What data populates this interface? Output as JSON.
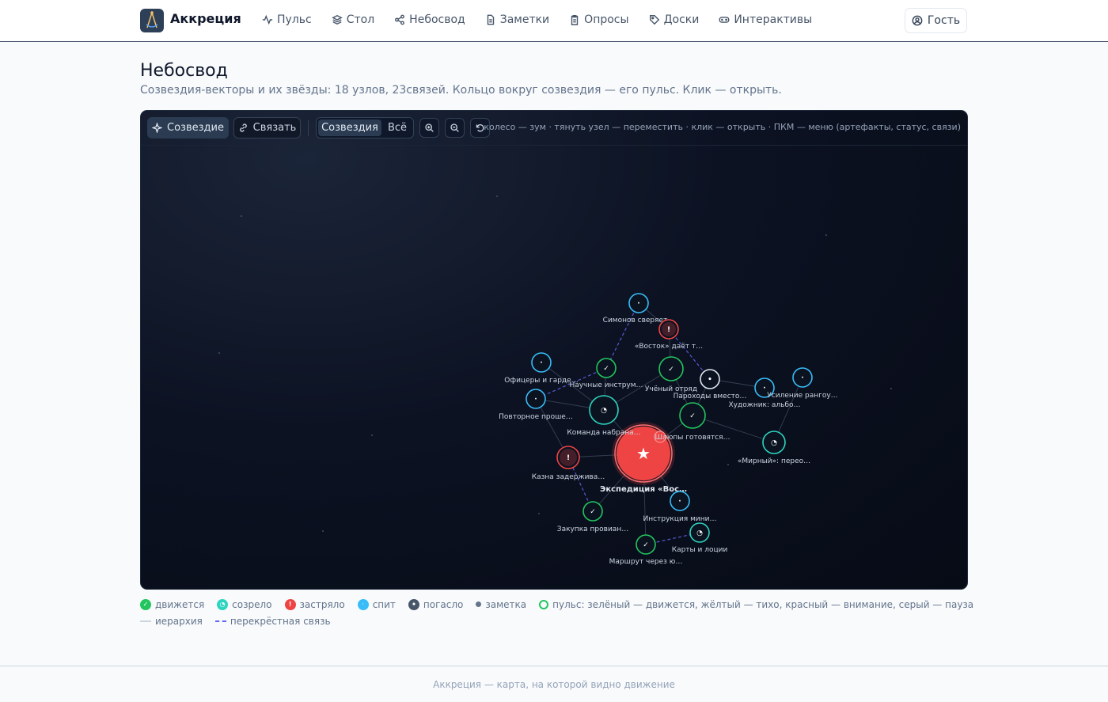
{
  "header": {
    "brand": "Аккреция",
    "nav": [
      {
        "label": "Пульс",
        "icon": "pulse-icon"
      },
      {
        "label": "Стол",
        "icon": "layers-icon"
      },
      {
        "label": "Небосвод",
        "icon": "share-nodes-icon"
      },
      {
        "label": "Заметки",
        "icon": "file-icon"
      },
      {
        "label": "Опросы",
        "icon": "clipboard-icon"
      },
      {
        "label": "Доски",
        "icon": "tag-icon"
      },
      {
        "label": "Интерактивы",
        "icon": "gamepad-icon"
      }
    ],
    "guest_label": "Гость"
  },
  "page": {
    "title": "Небосвод",
    "subtitle": "Созвездия-векторы и их звёзды: 18 узлов, 23связей. Кольцо вокруг созвездия — его пульс. Клик — открыть."
  },
  "toolbar": {
    "constellation_label": "Созвездие",
    "link_label": "Связать",
    "view_constellations": "Созвездия",
    "view_all": "Всё",
    "hint": "колесо — зум · тянуть узел — переместить · клик — открыть · ПКМ — меню (артефакты, статус, связи)"
  },
  "graph": {
    "colors": {
      "moving": "#22c55e",
      "ripe": "#2dd4bf",
      "stuck": "#ef4444",
      "sleeping": "#38bdf8",
      "faded": "#475569",
      "white": "#e2e8f0"
    },
    "nodes": [
      {
        "id": "main",
        "label": "Экспедиция «Вос…",
        "status": "stuck",
        "glyph": "★"
      },
      {
        "id": "simonov",
        "label": "Симонов сверяет…",
        "status": "sleeping",
        "glyph": "·"
      },
      {
        "id": "vostok",
        "label": "«Восток» даёт т…",
        "status": "stuck",
        "glyph": "!"
      },
      {
        "id": "officers",
        "label": "Офицеры и гарде…",
        "status": "sleeping",
        "glyph": "·"
      },
      {
        "id": "sci",
        "label": "Научные инструм…",
        "status": "moving",
        "glyph": "✓"
      },
      {
        "id": "scholar",
        "label": "Учёный отряд",
        "status": "moving",
        "glyph": "✓"
      },
      {
        "id": "steamers",
        "label": "Пароходы вместо…",
        "status": "white",
        "glyph": "•"
      },
      {
        "id": "artist",
        "label": "Художник: альбо…",
        "status": "sleeping",
        "glyph": "·"
      },
      {
        "id": "rangout",
        "label": "Усиление рангоу…",
        "status": "sleeping",
        "glyph": "·"
      },
      {
        "id": "repeat",
        "label": "Повторное проше…",
        "status": "sleeping",
        "glyph": "·"
      },
      {
        "id": "crew",
        "label": "Команда набрана…",
        "status": "ripe",
        "glyph": "◔"
      },
      {
        "id": "sloops",
        "label": "Шлюпы готовятся…",
        "status": "moving",
        "glyph": "✓"
      },
      {
        "id": "mirny",
        "label": "«Мирный»: перео…",
        "status": "ripe",
        "glyph": "◔"
      },
      {
        "id": "treasury",
        "label": "Казна задержива…",
        "status": "stuck",
        "glyph": "!"
      },
      {
        "id": "provisions",
        "label": "Закупка провиан…",
        "status": "moving",
        "glyph": "✓"
      },
      {
        "id": "instruct",
        "label": "Инструкция мини…",
        "status": "sleeping",
        "glyph": "·"
      },
      {
        "id": "maps",
        "label": "Карты и лоции",
        "status": "ripe",
        "glyph": "◔"
      },
      {
        "id": "route",
        "label": "Маршрут через ю…",
        "status": "moving",
        "glyph": "✓"
      }
    ],
    "edges": [
      [
        "main",
        "crew",
        "h"
      ],
      [
        "main",
        "sloops",
        "h"
      ],
      [
        "main",
        "treasury",
        "h"
      ],
      [
        "main",
        "instruct",
        "h"
      ],
      [
        "main",
        "route",
        "h"
      ],
      [
        "crew",
        "sci",
        "h"
      ],
      [
        "crew",
        "scholar",
        "h"
      ],
      [
        "crew",
        "officers",
        "h"
      ],
      [
        "crew",
        "repeat",
        "h"
      ],
      [
        "sloops",
        "steamers",
        "h"
      ],
      [
        "sloops",
        "mirny",
        "h"
      ],
      [
        "sloops",
        "scholar",
        "h"
      ],
      [
        "scholar",
        "vostok",
        "h"
      ],
      [
        "simonov",
        "vostok",
        "h"
      ],
      [
        "steamers",
        "artist",
        "h"
      ],
      [
        "mirny",
        "rangout",
        "h"
      ],
      [
        "treasury",
        "repeat",
        "h"
      ],
      [
        "provisions",
        "main",
        "h"
      ],
      [
        "route",
        "maps",
        "d"
      ],
      [
        "simonov",
        "sci",
        "d"
      ],
      [
        "sci",
        "repeat",
        "d"
      ],
      [
        "vostok",
        "steamers",
        "d"
      ],
      [
        "treasury",
        "provisions",
        "d"
      ]
    ]
  },
  "legend": {
    "items": [
      {
        "label": "движется",
        "glyph": "✓"
      },
      {
        "label": "созрело",
        "glyph": "◔"
      },
      {
        "label": "застряло",
        "glyph": "!"
      },
      {
        "label": "спит",
        "glyph": "·"
      },
      {
        "label": "погасло",
        "glyph": "✦"
      },
      {
        "label": "заметка"
      },
      {
        "label": "пульс: зелёный — движется, жёлтый — тихо, красный — внимание, серый — пауза"
      }
    ],
    "hierarchy_label": "иерархия",
    "cross_label": "перекрёстная связь"
  },
  "footer": {
    "text": "Аккреция — карта, на которой видно движение"
  }
}
